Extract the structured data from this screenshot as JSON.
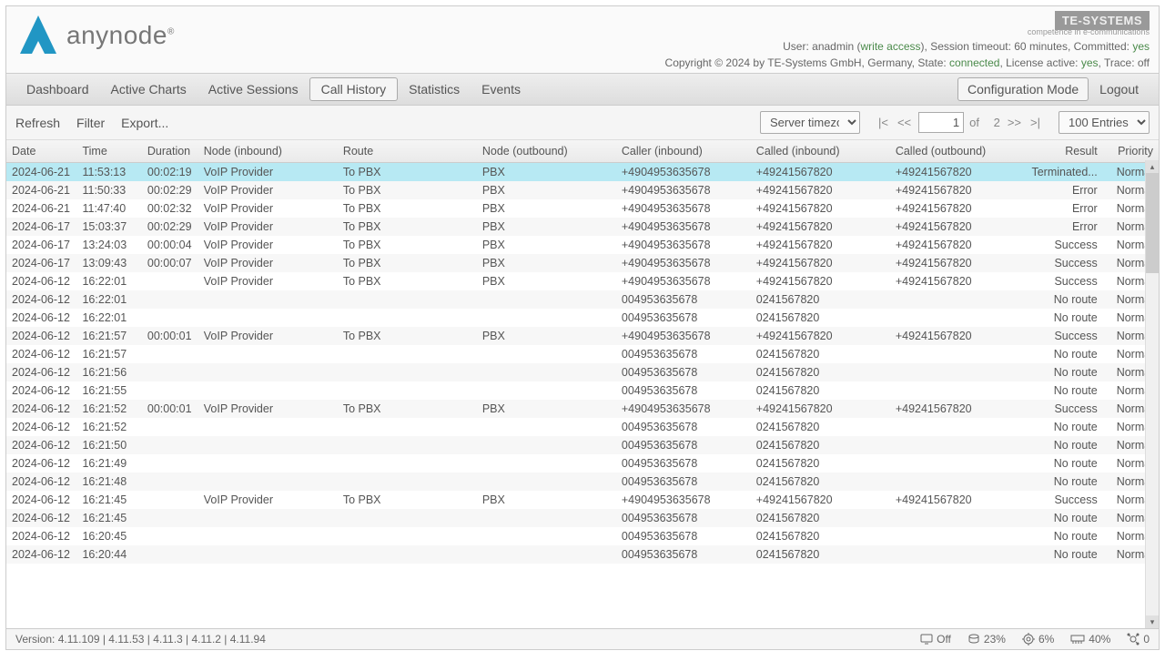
{
  "brand": {
    "name": "anynode",
    "reg": "®"
  },
  "header": {
    "te_logo": "TE-SYSTEMS",
    "te_sub": "competence in e-communications",
    "user_line_prefix": "User: anadmin (",
    "write_access": "write access",
    "user_line_mid": "), Session timeout: 60 minutes, Committed: ",
    "committed": "yes",
    "copy_prefix": "Copyright © 2024 by TE-Systems GmbH, Germany, State: ",
    "state": "connected",
    "copy_mid": ", License active: ",
    "license": "yes",
    "copy_tail": ", Trace: off"
  },
  "nav": {
    "items": [
      "Dashboard",
      "Active Charts",
      "Active Sessions",
      "Call History",
      "Statistics",
      "Events"
    ],
    "active": 3,
    "config_mode": "Configuration Mode",
    "logout": "Logout"
  },
  "toolbar": {
    "refresh": "Refresh",
    "filter": "Filter",
    "export": "Export...",
    "tz": "Server timezone",
    "page": "1",
    "of": "of",
    "pages_total": "2",
    "entries": "100 Entries"
  },
  "columns": [
    "Date",
    "Time",
    "Duration",
    "Node (inbound)",
    "Route",
    "Node (outbound)",
    "Caller (inbound)",
    "Called (inbound)",
    "Called (outbound)",
    "Result",
    "Priority"
  ],
  "rows": [
    {
      "d": "2024-06-21",
      "t": "11:53:13",
      "dur": "00:02:19",
      "in": "VoIP Provider",
      "r": "To PBX",
      "out": "PBX",
      "ci": "+4904953635678",
      "cd": "+49241567820",
      "co": "+49241567820",
      "res": "Terminated...",
      "pri": "Normal",
      "sel": true
    },
    {
      "d": "2024-06-21",
      "t": "11:50:33",
      "dur": "00:02:29",
      "in": "VoIP Provider",
      "r": "To PBX",
      "out": "PBX",
      "ci": "+4904953635678",
      "cd": "+49241567820",
      "co": "+49241567820",
      "res": "Error",
      "pri": "Normal"
    },
    {
      "d": "2024-06-21",
      "t": "11:47:40",
      "dur": "00:02:32",
      "in": "VoIP Provider",
      "r": "To PBX",
      "out": "PBX",
      "ci": "+4904953635678",
      "cd": "+49241567820",
      "co": "+49241567820",
      "res": "Error",
      "pri": "Normal"
    },
    {
      "d": "2024-06-17",
      "t": "15:03:37",
      "dur": "00:02:29",
      "in": "VoIP Provider",
      "r": "To PBX",
      "out": "PBX",
      "ci": "+4904953635678",
      "cd": "+49241567820",
      "co": "+49241567820",
      "res": "Error",
      "pri": "Normal"
    },
    {
      "d": "2024-06-17",
      "t": "13:24:03",
      "dur": "00:00:04",
      "in": "VoIP Provider",
      "r": "To PBX",
      "out": "PBX",
      "ci": "+4904953635678",
      "cd": "+49241567820",
      "co": "+49241567820",
      "res": "Success",
      "pri": "Normal"
    },
    {
      "d": "2024-06-17",
      "t": "13:09:43",
      "dur": "00:00:07",
      "in": "VoIP Provider",
      "r": "To PBX",
      "out": "PBX",
      "ci": "+4904953635678",
      "cd": "+49241567820",
      "co": "+49241567820",
      "res": "Success",
      "pri": "Normal"
    },
    {
      "d": "2024-06-12",
      "t": "16:22:01",
      "dur": "",
      "in": "VoIP Provider",
      "r": "To PBX",
      "out": "PBX",
      "ci": "+4904953635678",
      "cd": "+49241567820",
      "co": "+49241567820",
      "res": "Success",
      "pri": "Normal"
    },
    {
      "d": "2024-06-12",
      "t": "16:22:01",
      "dur": "",
      "in": "",
      "r": "",
      "out": "",
      "ci": "004953635678",
      "cd": "0241567820",
      "co": "",
      "res": "No route",
      "pri": "Normal"
    },
    {
      "d": "2024-06-12",
      "t": "16:22:01",
      "dur": "",
      "in": "",
      "r": "",
      "out": "",
      "ci": "004953635678",
      "cd": "0241567820",
      "co": "",
      "res": "No route",
      "pri": "Normal"
    },
    {
      "d": "2024-06-12",
      "t": "16:21:57",
      "dur": "00:00:01",
      "in": "VoIP Provider",
      "r": "To PBX",
      "out": "PBX",
      "ci": "+4904953635678",
      "cd": "+49241567820",
      "co": "+49241567820",
      "res": "Success",
      "pri": "Normal"
    },
    {
      "d": "2024-06-12",
      "t": "16:21:57",
      "dur": "",
      "in": "",
      "r": "",
      "out": "",
      "ci": "004953635678",
      "cd": "0241567820",
      "co": "",
      "res": "No route",
      "pri": "Normal"
    },
    {
      "d": "2024-06-12",
      "t": "16:21:56",
      "dur": "",
      "in": "",
      "r": "",
      "out": "",
      "ci": "004953635678",
      "cd": "0241567820",
      "co": "",
      "res": "No route",
      "pri": "Normal"
    },
    {
      "d": "2024-06-12",
      "t": "16:21:55",
      "dur": "",
      "in": "",
      "r": "",
      "out": "",
      "ci": "004953635678",
      "cd": "0241567820",
      "co": "",
      "res": "No route",
      "pri": "Normal"
    },
    {
      "d": "2024-06-12",
      "t": "16:21:52",
      "dur": "00:00:01",
      "in": "VoIP Provider",
      "r": "To PBX",
      "out": "PBX",
      "ci": "+4904953635678",
      "cd": "+49241567820",
      "co": "+49241567820",
      "res": "Success",
      "pri": "Normal"
    },
    {
      "d": "2024-06-12",
      "t": "16:21:52",
      "dur": "",
      "in": "",
      "r": "",
      "out": "",
      "ci": "004953635678",
      "cd": "0241567820",
      "co": "",
      "res": "No route",
      "pri": "Normal"
    },
    {
      "d": "2024-06-12",
      "t": "16:21:50",
      "dur": "",
      "in": "",
      "r": "",
      "out": "",
      "ci": "004953635678",
      "cd": "0241567820",
      "co": "",
      "res": "No route",
      "pri": "Normal"
    },
    {
      "d": "2024-06-12",
      "t": "16:21:49",
      "dur": "",
      "in": "",
      "r": "",
      "out": "",
      "ci": "004953635678",
      "cd": "0241567820",
      "co": "",
      "res": "No route",
      "pri": "Normal"
    },
    {
      "d": "2024-06-12",
      "t": "16:21:48",
      "dur": "",
      "in": "",
      "r": "",
      "out": "",
      "ci": "004953635678",
      "cd": "0241567820",
      "co": "",
      "res": "No route",
      "pri": "Normal"
    },
    {
      "d": "2024-06-12",
      "t": "16:21:45",
      "dur": "",
      "in": "VoIP Provider",
      "r": "To PBX",
      "out": "PBX",
      "ci": "+4904953635678",
      "cd": "+49241567820",
      "co": "+49241567820",
      "res": "Success",
      "pri": "Normal"
    },
    {
      "d": "2024-06-12",
      "t": "16:21:45",
      "dur": "",
      "in": "",
      "r": "",
      "out": "",
      "ci": "004953635678",
      "cd": "0241567820",
      "co": "",
      "res": "No route",
      "pri": "Normal"
    },
    {
      "d": "2024-06-12",
      "t": "16:20:45",
      "dur": "",
      "in": "",
      "r": "",
      "out": "",
      "ci": "004953635678",
      "cd": "0241567820",
      "co": "",
      "res": "No route",
      "pri": "Normal"
    },
    {
      "d": "2024-06-12",
      "t": "16:20:44",
      "dur": "",
      "in": "",
      "r": "",
      "out": "",
      "ci": "004953635678",
      "cd": "0241567820",
      "co": "",
      "res": "No route",
      "pri": "Normal"
    }
  ],
  "footer": {
    "version": "Version: 4.11.109 | 4.11.53 | 4.11.3 | 4.11.2 | 4.11.94",
    "off": "Off",
    "disk": "23%",
    "cpu": "6%",
    "mem": "40%",
    "net": "0"
  }
}
